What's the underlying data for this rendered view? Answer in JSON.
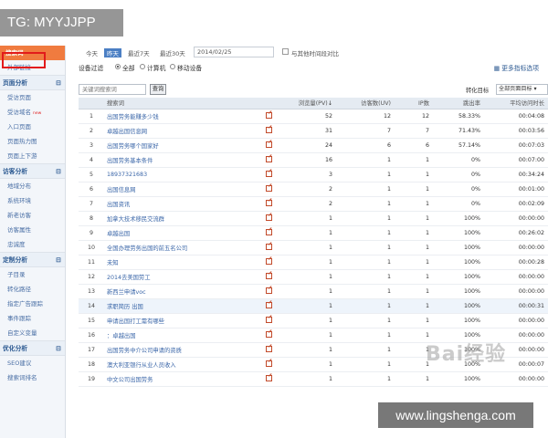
{
  "watermark_top": "TG: MYYJJPP",
  "watermark_bottom": "www.lingshenga.com",
  "watermark_baidu": "Bai经验",
  "sidebar": {
    "items": [
      {
        "label": "搜索词",
        "type": "item",
        "active": true
      },
      {
        "label": "外部链接",
        "type": "sub"
      },
      {
        "label": "页面分析",
        "type": "head"
      },
      {
        "label": "受访页面",
        "type": "sub"
      },
      {
        "label": "受访域名",
        "type": "sub",
        "badge": "new"
      },
      {
        "label": "入口页面",
        "type": "sub"
      },
      {
        "label": "页面热力图",
        "type": "sub"
      },
      {
        "label": "页面上下游",
        "type": "sub"
      },
      {
        "label": "访客分析",
        "type": "head"
      },
      {
        "label": "地域分布",
        "type": "sub"
      },
      {
        "label": "系统环境",
        "type": "sub"
      },
      {
        "label": "新老访客",
        "type": "sub"
      },
      {
        "label": "访客属性",
        "type": "sub"
      },
      {
        "label": "忠诚度",
        "type": "sub"
      },
      {
        "label": "定制分析",
        "type": "head"
      },
      {
        "label": "子目录",
        "type": "sub"
      },
      {
        "label": "转化路径",
        "type": "sub"
      },
      {
        "label": "指定广告跟踪",
        "type": "sub"
      },
      {
        "label": "事件跟踪",
        "type": "sub"
      },
      {
        "label": "自定义变量",
        "type": "sub"
      },
      {
        "label": "优化分析",
        "type": "head"
      },
      {
        "label": "SEO建议",
        "type": "sub"
      },
      {
        "label": "搜索词排名",
        "type": "sub"
      }
    ],
    "toggle": "⊟"
  },
  "toolbar": {
    "today": "今天",
    "yesterday": "昨天",
    "last7": "最近7天",
    "last30": "最近30天",
    "date": "2014/02/25",
    "compare": "与其他时间段对比"
  },
  "filter": {
    "label": "设备过滤",
    "options": [
      "全部",
      "计算机",
      "移动设备"
    ],
    "more": "更多指标选项"
  },
  "search": {
    "placeholder": "关键词搜索词",
    "button": "查询",
    "conversion_label": "转化目标",
    "conversion_value": "全部页面目标"
  },
  "table": {
    "headers": [
      "",
      "搜索词",
      "",
      "浏览量(PV)",
      "访客数(UV)",
      "IP数",
      "跳出率",
      "平均访问时长"
    ],
    "sort_arrow": "↓",
    "rows": [
      {
        "n": "1",
        "kw": "出国劳务能赚多少钱",
        "pv": "52",
        "uv": "12",
        "ip": "12",
        "bounce": "58.33%",
        "dur": "00:04:08"
      },
      {
        "n": "2",
        "kw": "卓越出国信息网",
        "pv": "31",
        "uv": "7",
        "ip": "7",
        "bounce": "71.43%",
        "dur": "00:03:56"
      },
      {
        "n": "3",
        "kw": "出国劳务哪个国家好",
        "pv": "24",
        "uv": "6",
        "ip": "6",
        "bounce": "57.14%",
        "dur": "00:07:03"
      },
      {
        "n": "4",
        "kw": "出国劳务基本条件",
        "pv": "16",
        "uv": "1",
        "ip": "1",
        "bounce": "0%",
        "dur": "00:07:00"
      },
      {
        "n": "5",
        "kw": "18937321683",
        "pv": "3",
        "uv": "1",
        "ip": "1",
        "bounce": "0%",
        "dur": "00:34:24"
      },
      {
        "n": "6",
        "kw": "出国信息网",
        "pv": "2",
        "uv": "1",
        "ip": "1",
        "bounce": "0%",
        "dur": "00:01:00"
      },
      {
        "n": "7",
        "kw": "出国资讯",
        "pv": "2",
        "uv": "1",
        "ip": "1",
        "bounce": "0%",
        "dur": "00:02:09"
      },
      {
        "n": "8",
        "kw": "加拿大技术移民交流群",
        "pv": "1",
        "uv": "1",
        "ip": "1",
        "bounce": "100%",
        "dur": "00:00:00"
      },
      {
        "n": "9",
        "kw": "卓越出国",
        "pv": "1",
        "uv": "1",
        "ip": "1",
        "bounce": "100%",
        "dur": "00:26:02"
      },
      {
        "n": "10",
        "kw": "全国办理劳务出国的前五名公司",
        "pv": "1",
        "uv": "1",
        "ip": "1",
        "bounce": "100%",
        "dur": "00:00:00"
      },
      {
        "n": "11",
        "kw": "未知",
        "pv": "1",
        "uv": "1",
        "ip": "1",
        "bounce": "100%",
        "dur": "00:00:28"
      },
      {
        "n": "12",
        "kw": "2014去美国劳工",
        "pv": "1",
        "uv": "1",
        "ip": "1",
        "bounce": "100%",
        "dur": "00:00:00"
      },
      {
        "n": "13",
        "kw": "新西兰申请voc",
        "pv": "1",
        "uv": "1",
        "ip": "1",
        "bounce": "100%",
        "dur": "00:00:00"
      },
      {
        "n": "14",
        "kw": "求职简历 出国",
        "pv": "1",
        "uv": "1",
        "ip": "1",
        "bounce": "100%",
        "dur": "00:00:31"
      },
      {
        "n": "15",
        "kw": "申请出国打工需有哪些",
        "pv": "1",
        "uv": "1",
        "ip": "1",
        "bounce": "100%",
        "dur": "00:00:00"
      },
      {
        "n": "16",
        "kw": "：卓越出国",
        "pv": "1",
        "uv": "1",
        "ip": "1",
        "bounce": "100%",
        "dur": "00:00:00"
      },
      {
        "n": "17",
        "kw": "出国劳务中介公司申请的资质",
        "pv": "1",
        "uv": "1",
        "ip": "1",
        "bounce": "100%",
        "dur": "00:00:00"
      },
      {
        "n": "18",
        "kw": "澳大利亚银行从业人员收入",
        "pv": "1",
        "uv": "1",
        "ip": "1",
        "bounce": "100%",
        "dur": "00:00:07"
      },
      {
        "n": "19",
        "kw": "中文公司出国劳务",
        "pv": "1",
        "uv": "1",
        "ip": "1",
        "bounce": "100%",
        "dur": "00:00:00"
      }
    ]
  }
}
